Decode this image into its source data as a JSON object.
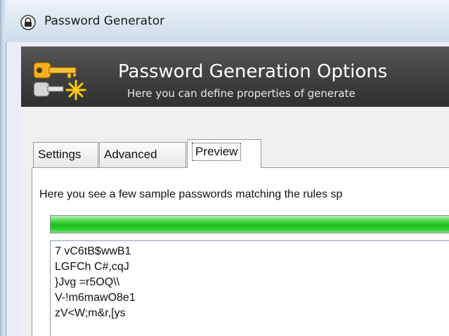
{
  "window": {
    "title": "Password Generator",
    "icon": "lock-icon"
  },
  "banner": {
    "heading": "Password Generation Options",
    "subheading": "Here you can define properties of generate",
    "icon": "keys-icon"
  },
  "tabs": [
    {
      "label": "Settings",
      "selected": false
    },
    {
      "label": "Advanced",
      "selected": false
    },
    {
      "label": "Preview",
      "selected": true
    }
  ],
  "preview": {
    "description": "Here you see a few sample passwords matching the rules sp",
    "progress_percent": 100,
    "passwords": [
      "7 vC6tB$wwB1",
      "LGFCh C#,cqJ",
      "}Jvg =r5OQ\\\\",
      "V-!m6mawO8e1",
      "zV<W;m&r,[ys"
    ]
  },
  "colors": {
    "progress": "#22c322",
    "banner": "#3f3f3f"
  }
}
